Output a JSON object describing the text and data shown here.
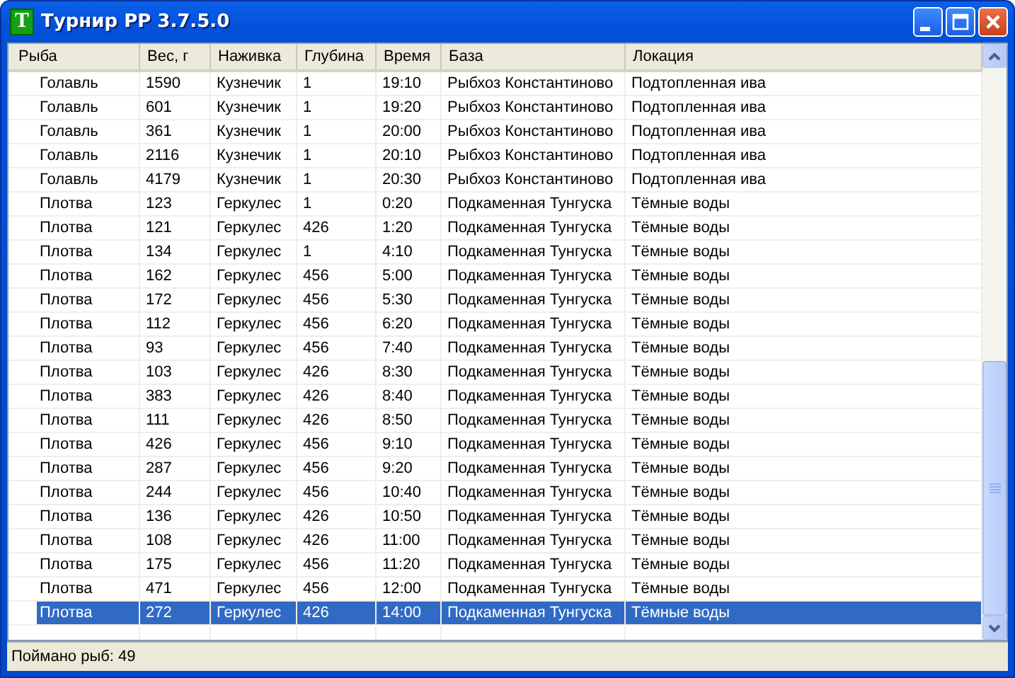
{
  "window": {
    "title": "Турнир РР 3.7.5.0",
    "app_icon_letter": "T"
  },
  "table": {
    "columns": [
      "Рыба",
      "Вес, г",
      "Наживка",
      "Глубина",
      "Время",
      "База",
      "Локация"
    ],
    "rows": [
      {
        "cells": [
          "Голавль",
          "1590",
          "Кузнечик",
          "1",
          "19:10",
          "Рыбхоз Константиново",
          "Подтопленная ива"
        ],
        "selected": false
      },
      {
        "cells": [
          "Голавль",
          "601",
          "Кузнечик",
          "1",
          "19:20",
          "Рыбхоз Константиново",
          "Подтопленная ива"
        ],
        "selected": false
      },
      {
        "cells": [
          "Голавль",
          "361",
          "Кузнечик",
          "1",
          "20:00",
          "Рыбхоз Константиново",
          "Подтопленная ива"
        ],
        "selected": false
      },
      {
        "cells": [
          "Голавль",
          "2116",
          "Кузнечик",
          "1",
          "20:10",
          "Рыбхоз Константиново",
          "Подтопленная ива"
        ],
        "selected": false
      },
      {
        "cells": [
          "Голавль",
          "4179",
          "Кузнечик",
          "1",
          "20:30",
          "Рыбхоз Константиново",
          "Подтопленная ива"
        ],
        "selected": false
      },
      {
        "cells": [
          "Плотва",
          "123",
          "Геркулес",
          "1",
          "0:20",
          "Подкаменная Тунгуска",
          "Тёмные воды"
        ],
        "selected": false
      },
      {
        "cells": [
          "Плотва",
          "121",
          "Геркулес",
          "426",
          "1:20",
          "Подкаменная Тунгуска",
          "Тёмные воды"
        ],
        "selected": false
      },
      {
        "cells": [
          "Плотва",
          "134",
          "Геркулес",
          "1",
          "4:10",
          "Подкаменная Тунгуска",
          "Тёмные воды"
        ],
        "selected": false
      },
      {
        "cells": [
          "Плотва",
          "162",
          "Геркулес",
          "456",
          "5:00",
          "Подкаменная Тунгуска",
          "Тёмные воды"
        ],
        "selected": false
      },
      {
        "cells": [
          "Плотва",
          "172",
          "Геркулес",
          "456",
          "5:30",
          "Подкаменная Тунгуска",
          "Тёмные воды"
        ],
        "selected": false
      },
      {
        "cells": [
          "Плотва",
          "112",
          "Геркулес",
          "456",
          "6:20",
          "Подкаменная Тунгуска",
          "Тёмные воды"
        ],
        "selected": false
      },
      {
        "cells": [
          "Плотва",
          "93",
          "Геркулес",
          "456",
          "7:40",
          "Подкаменная Тунгуска",
          "Тёмные воды"
        ],
        "selected": false
      },
      {
        "cells": [
          "Плотва",
          "103",
          "Геркулес",
          "426",
          "8:30",
          "Подкаменная Тунгуска",
          "Тёмные воды"
        ],
        "selected": false
      },
      {
        "cells": [
          "Плотва",
          "383",
          "Геркулес",
          "426",
          "8:40",
          "Подкаменная Тунгуска",
          "Тёмные воды"
        ],
        "selected": false
      },
      {
        "cells": [
          "Плотва",
          "111",
          "Геркулес",
          "426",
          "8:50",
          "Подкаменная Тунгуска",
          "Тёмные воды"
        ],
        "selected": false
      },
      {
        "cells": [
          "Плотва",
          "426",
          "Геркулес",
          "456",
          "9:10",
          "Подкаменная Тунгуска",
          "Тёмные воды"
        ],
        "selected": false
      },
      {
        "cells": [
          "Плотва",
          "287",
          "Геркулес",
          "456",
          "9:20",
          "Подкаменная Тунгуска",
          "Тёмные воды"
        ],
        "selected": false
      },
      {
        "cells": [
          "Плотва",
          "244",
          "Геркулес",
          "456",
          "10:40",
          "Подкаменная Тунгуска",
          "Тёмные воды"
        ],
        "selected": false
      },
      {
        "cells": [
          "Плотва",
          "136",
          "Геркулес",
          "426",
          "10:50",
          "Подкаменная Тунгуска",
          "Тёмные воды"
        ],
        "selected": false
      },
      {
        "cells": [
          "Плотва",
          "108",
          "Геркулес",
          "426",
          "11:00",
          "Подкаменная Тунгуска",
          "Тёмные воды"
        ],
        "selected": false
      },
      {
        "cells": [
          "Плотва",
          "175",
          "Геркулес",
          "456",
          "11:20",
          "Подкаменная Тунгуска",
          "Тёмные воды"
        ],
        "selected": false
      },
      {
        "cells": [
          "Плотва",
          "471",
          "Геркулес",
          "456",
          "12:00",
          "Подкаменная Тунгуска",
          "Тёмные воды"
        ],
        "selected": false
      },
      {
        "cells": [
          "Плотва",
          "272",
          "Геркулес",
          "426",
          "14:00",
          "Подкаменная Тунгуска",
          "Тёмные воды"
        ],
        "selected": true
      }
    ]
  },
  "status_bar": "Поймано рыб: 49"
}
